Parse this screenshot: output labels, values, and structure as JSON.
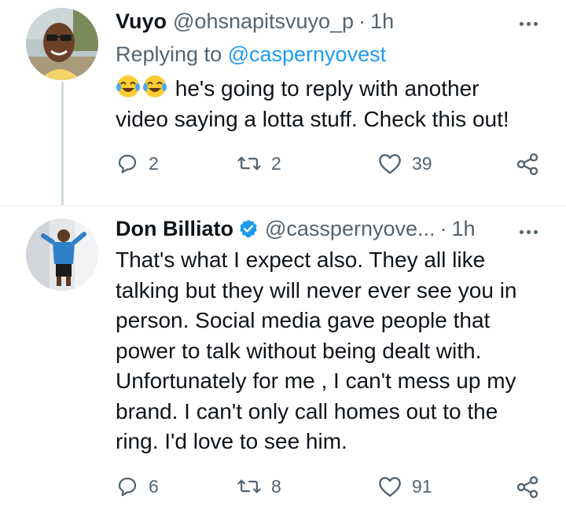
{
  "tweets": [
    {
      "display_name": "Vuyo",
      "handle": "@ohsnapitsvuyo_p",
      "separator": "·",
      "time": "1h",
      "replying_prefix": "Replying to ",
      "replying_to": "@caspernyovest",
      "emoji": [
        "face-with-tears-of-joy",
        "face-with-tears-of-joy"
      ],
      "text": "he's going to reply with another\nvideo saying a lotta stuff. Check this out!",
      "replies": "2",
      "retweets": "2",
      "likes": "39"
    },
    {
      "display_name": "Don Billiato",
      "verified": true,
      "handle": "@casspernyove...",
      "separator": "·",
      "time": "1h",
      "text": "That's what I expect also. They all like\ntalking but they will never ever see you in\nperson. Social media gave people that\npower to talk without being dealt with.\nUnfortunately for me , I can't mess up my\nbrand. I can't only call homes out to the\nring. I'd love to see him.",
      "replies": "6",
      "retweets": "8",
      "likes": "91"
    }
  ],
  "colors": {
    "text": "#0f1419",
    "secondary": "#536471",
    "link": "#1d9bf0",
    "verified": "#1d9bf0",
    "thread_line": "#cfd9de"
  },
  "icons": [
    "reply-icon",
    "retweet-icon",
    "like-icon",
    "share-icon",
    "more-icon",
    "verified-badge-icon"
  ]
}
